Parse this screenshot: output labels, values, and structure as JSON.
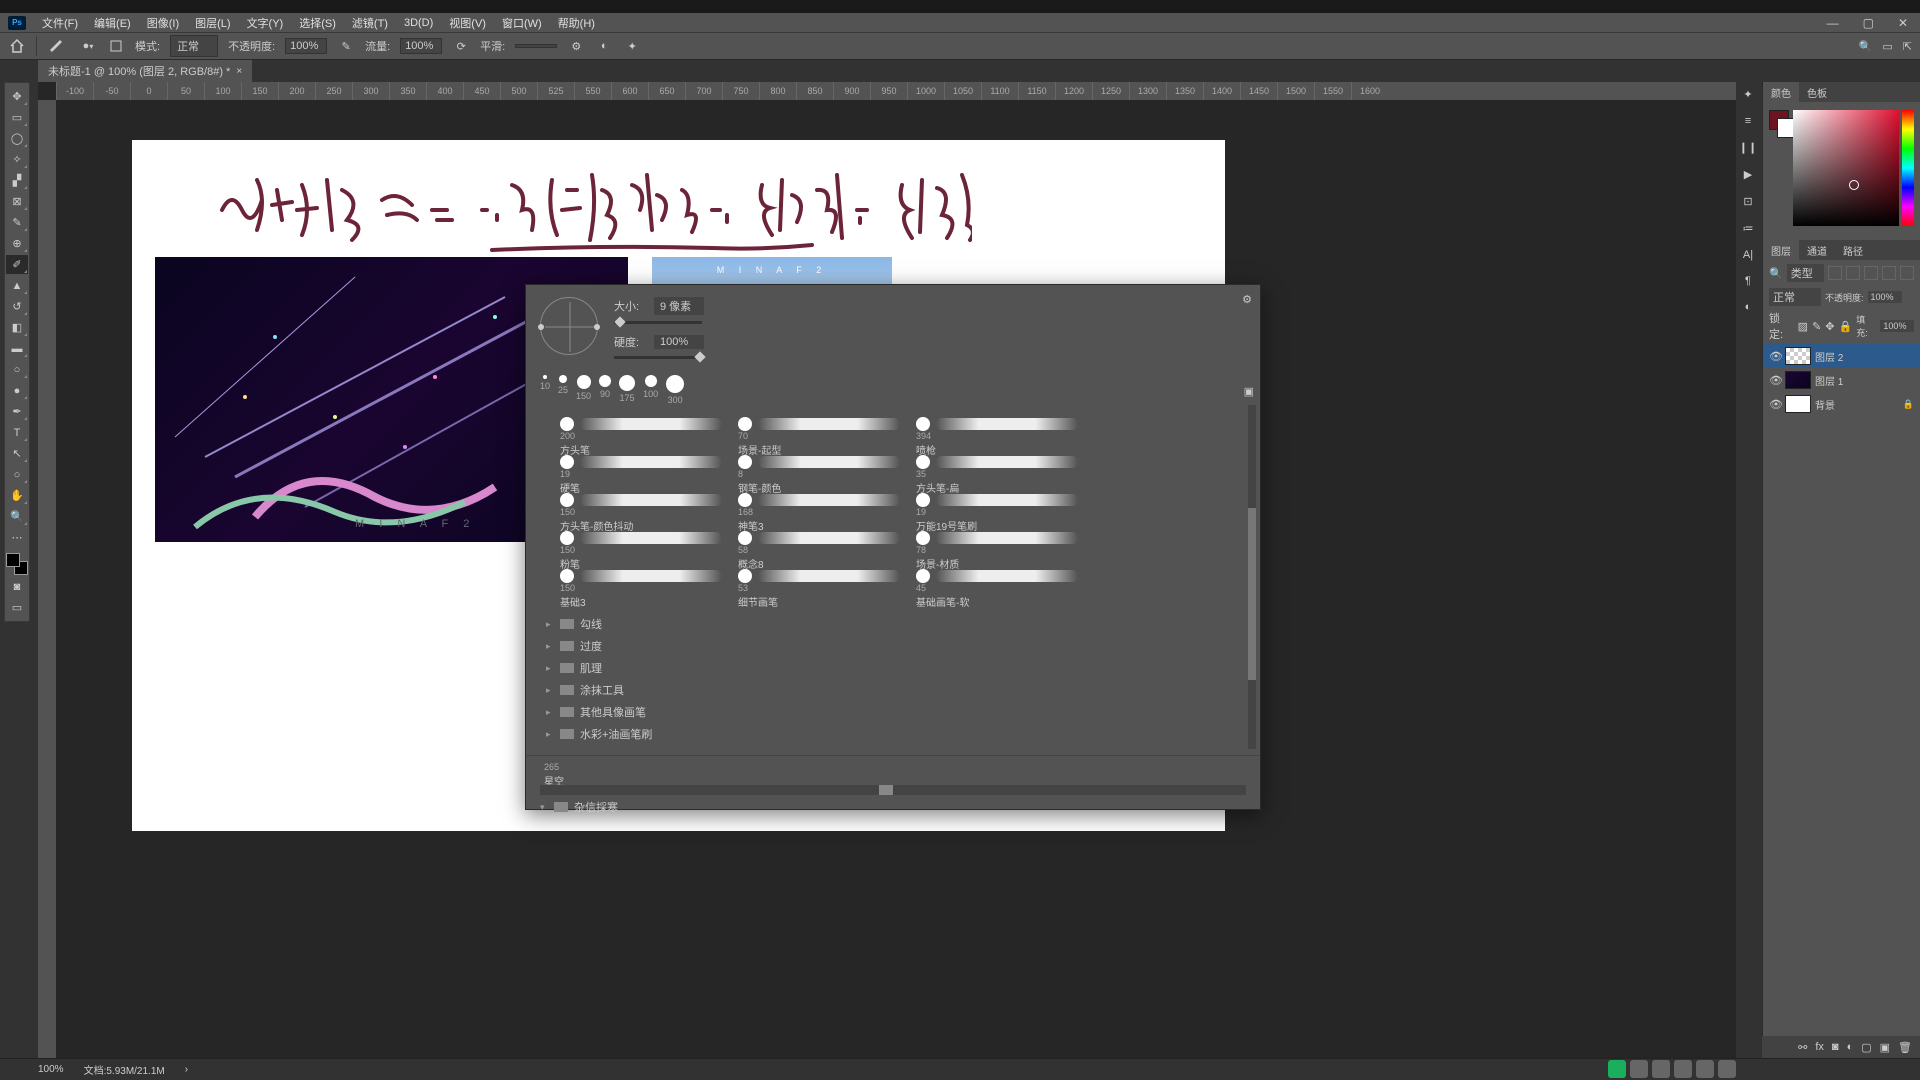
{
  "menu": [
    "文件(F)",
    "编辑(E)",
    "图像(I)",
    "图层(L)",
    "文字(Y)",
    "选择(S)",
    "滤镜(T)",
    "3D(D)",
    "视图(V)",
    "窗口(W)",
    "帮助(H)"
  ],
  "optionbar": {
    "mode_label": "模式:",
    "mode_value": "正常",
    "opacity_label": "不透明度:",
    "opacity_value": "100%",
    "flow_label": "流量:",
    "flow_value": "100%",
    "smooth_label": "平滑:"
  },
  "doctab": {
    "title": "未标题-1 @ 100% (图层 2, RGB/8#) *"
  },
  "ruler": [
    "-100",
    "-50",
    "0",
    "50",
    "100",
    "150",
    "200",
    "250",
    "300",
    "350",
    "400",
    "450",
    "500",
    "525",
    "550",
    "600",
    "650",
    "700",
    "750",
    "800",
    "850",
    "900",
    "950",
    "1000",
    "1050",
    "1100",
    "1150",
    "1200",
    "1250",
    "1300",
    "1350",
    "1400",
    "1450",
    "1500",
    "1550",
    "1600"
  ],
  "brushpanel": {
    "size_label": "大小:",
    "size_value": "9 像素",
    "hardness_label": "硬度:",
    "hardness_value": "100%",
    "presets": [
      {
        "s": "10"
      },
      {
        "s": "25"
      },
      {
        "s": "150"
      },
      {
        "s": "90"
      },
      {
        "s": "175"
      },
      {
        "s": "100"
      },
      {
        "s": "300"
      }
    ],
    "brushes": [
      [
        {
          "sz": "200",
          "name": "方头笔"
        },
        {
          "sz": "70",
          "name": "场景-起型"
        },
        {
          "sz": "394",
          "name": "喷枪"
        }
      ],
      [
        {
          "sz": "19",
          "name": "硬笔"
        },
        {
          "sz": "8",
          "name": "钢笔-颜色"
        },
        {
          "sz": "35",
          "name": "方头笔-扁"
        }
      ],
      [
        {
          "sz": "150",
          "name": "方头笔-颜色抖动"
        },
        {
          "sz": "168",
          "name": "神笔3"
        },
        {
          "sz": "19",
          "name": "万能19号笔刷"
        }
      ],
      [
        {
          "sz": "150",
          "name": "粉笔"
        },
        {
          "sz": "58",
          "name": "概念8"
        },
        {
          "sz": "78",
          "name": "场景-材质"
        }
      ],
      [
        {
          "sz": "150",
          "name": "基础3"
        },
        {
          "sz": "53",
          "name": "细节画笔"
        },
        {
          "sz": "45",
          "name": "基础画笔-软"
        }
      ]
    ],
    "folders": [
      "勾线",
      "过度",
      "肌理",
      "涂抹工具",
      "其他具像画笔",
      "水彩+油画笔刷"
    ],
    "bottom_preset": {
      "sz": "265",
      "name": "星空"
    },
    "bottom_folder": "杂信採寒"
  },
  "panels": {
    "color_tabs": [
      "颜色",
      "色板"
    ],
    "layer_tabs": [
      "图层",
      "通道",
      "路径"
    ],
    "kind_label": "类型",
    "blend": "正常",
    "opacity_label": "不透明度:",
    "opacity_value": "100%",
    "lock_label": "锁定:",
    "fill_label": "填充:",
    "fill_value": "100%",
    "layers": [
      {
        "name": "图层 2",
        "sel": true,
        "thumb": "trans"
      },
      {
        "name": "图层 1",
        "thumb": "dark"
      },
      {
        "name": "背景",
        "lock": true,
        "thumb": "white"
      }
    ]
  },
  "status": {
    "zoom": "100%",
    "docinfo": "文档:5.93M/21.1M"
  }
}
